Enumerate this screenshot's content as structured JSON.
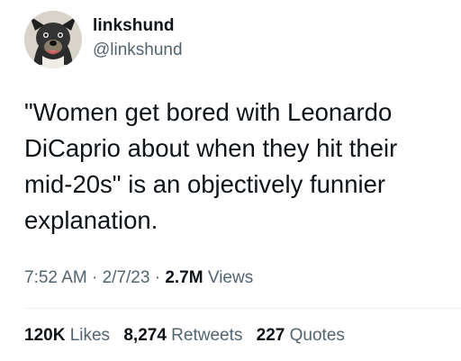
{
  "author": {
    "display_name": "linkshund",
    "handle": "@linkshund",
    "avatar_icon": "dog-avatar-icon"
  },
  "tweet": {
    "text": "\"Women get bored with Leonardo\nDiCaprio about when they hit their\nmid-20s\" is an objectively funnier\nexplanation."
  },
  "meta": {
    "time": "7:52 AM",
    "separator": "·",
    "date": "2/7/23",
    "views_count": "2.7M",
    "views_label": "Views"
  },
  "stats": {
    "likes_count": "120K",
    "likes_label": "Likes",
    "retweets_count": "8,274",
    "retweets_label": "Retweets",
    "quotes_count": "227",
    "quotes_label": "Quotes"
  },
  "colors": {
    "text_primary": "#0f1419",
    "text_secondary": "#536471",
    "divider": "#eff3f4"
  }
}
